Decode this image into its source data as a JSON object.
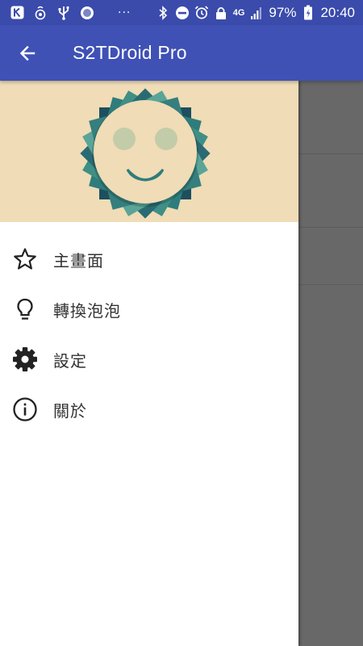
{
  "status_bar": {
    "battery": "97%",
    "time": "20:40",
    "network_label": "4G",
    "overflow": "···"
  },
  "app_bar": {
    "title": "S2TDroid Pro"
  },
  "drawer": {
    "items": [
      {
        "label": "主畫面",
        "icon": "star-outline-icon"
      },
      {
        "label": "轉換泡泡",
        "icon": "lightbulb-icon"
      },
      {
        "label": "設定",
        "icon": "gear-icon"
      },
      {
        "label": "關於",
        "icon": "info-icon"
      }
    ]
  },
  "colors": {
    "primary": "#3f51b5",
    "status_bar": "#3a4bab",
    "header_bg": "#f0dcb6",
    "logo_teal": "#2e7d7c",
    "scrim": "#686868"
  }
}
